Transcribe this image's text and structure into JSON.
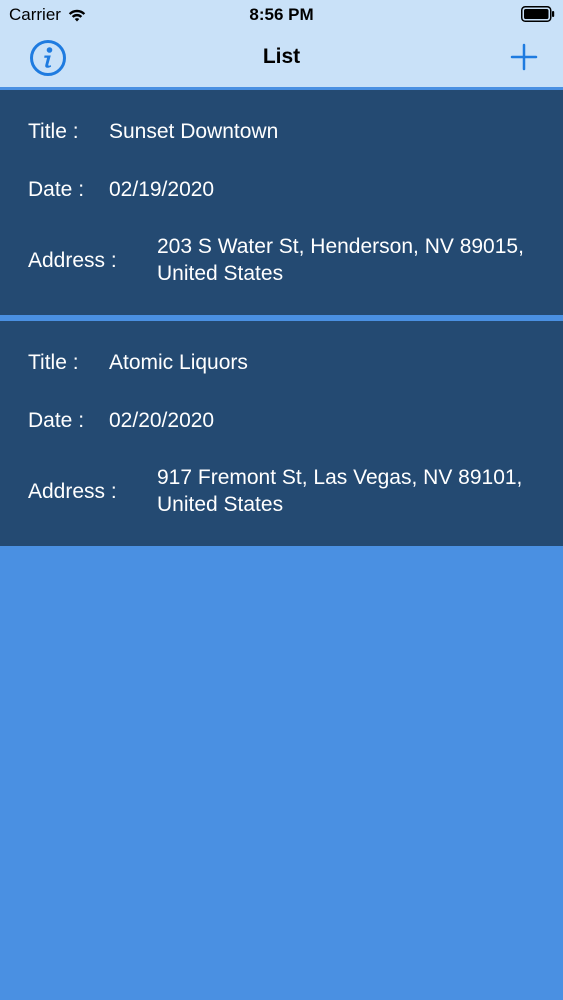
{
  "status_bar": {
    "carrier": "Carrier",
    "time": "8:56 PM"
  },
  "nav": {
    "title": "List"
  },
  "colors": {
    "nav_background": "#C9E1F8",
    "card_background": "#244A72",
    "page_background": "#4A90E2",
    "accent": "#1E7BE0"
  },
  "icons": {
    "left": "info-icon",
    "right": "plus-icon"
  },
  "labels": {
    "title": "Title :",
    "date": "Date :",
    "address": "Address :"
  },
  "items": [
    {
      "title": "Sunset Downtown",
      "date": "02/19/2020",
      "address": "203 S Water St, Henderson, NV 89015, United States"
    },
    {
      "title": "Atomic Liquors",
      "date": "02/20/2020",
      "address": "917 Fremont St, Las Vegas, NV 89101, United States"
    }
  ]
}
